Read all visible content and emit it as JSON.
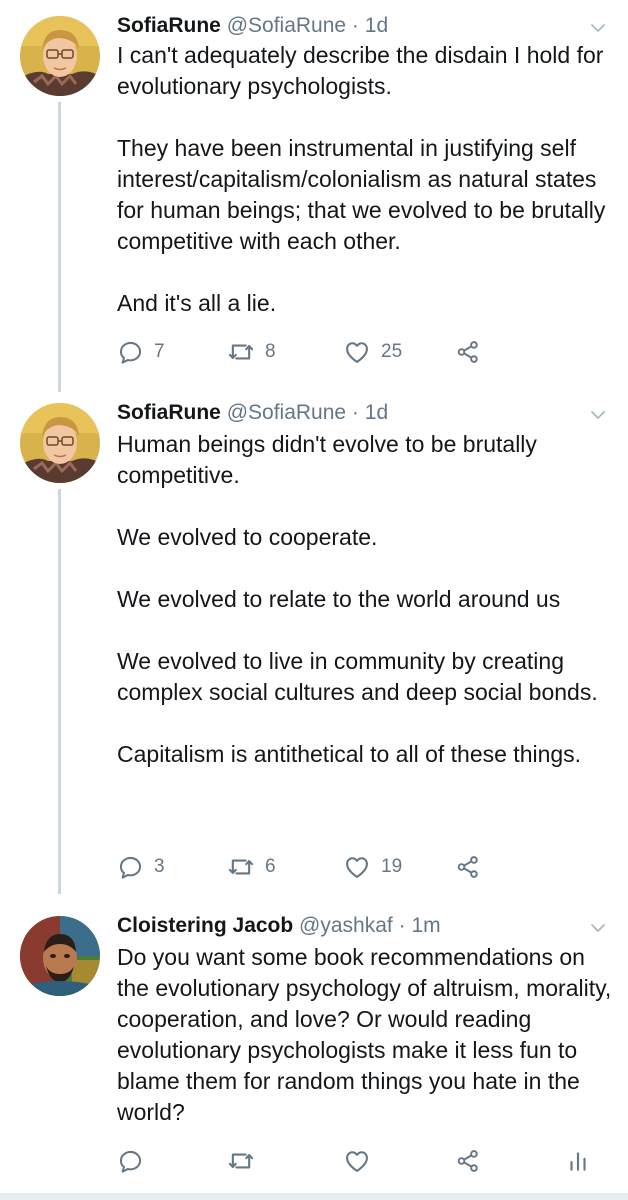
{
  "tweets": [
    {
      "name": "SofiaRune",
      "handle": "@SofiaRune",
      "separator": "·",
      "time": "1d",
      "paragraphs": [
        "I can't adequately describe the disdain I hold for evolutionary psychologists.",
        "They have been instrumental in justifying self interest/capitalism/colonialism as natural states for human beings; that we evolved to be brutally competitive with each other.",
        "And it's all a lie."
      ],
      "replies": "7",
      "retweets": "8",
      "likes": "25"
    },
    {
      "name": "SofiaRune",
      "handle": "@SofiaRune",
      "separator": "·",
      "time": "1d",
      "paragraphs": [
        "Human beings didn't evolve to be brutally competitive.",
        "We evolved to cooperate.",
        "We evolved to relate to the world around us",
        "We evolved to live in community by creating complex social cultures and deep social bonds.",
        "Capitalism is antithetical to all of these things."
      ],
      "replies": "3",
      "retweets": "6",
      "likes": "19"
    },
    {
      "name": "Cloistering Jacob",
      "handle": "@yashkaf",
      "separator": "·",
      "time": "1m",
      "paragraphs": [
        "Do you want some book recommendations on the evolutionary psychology of altruism, morality, cooperation, and love? Or would reading evolutionary psychologists make it less fun to blame them for random things you hate in the world?"
      ]
    }
  ],
  "icons": {
    "reply": "reply-icon",
    "retweet": "retweet-icon",
    "like": "heart-icon",
    "share": "share-icon",
    "analytics": "analytics-icon",
    "caret": "chevron-down-icon"
  },
  "colors": {
    "text": "#14171a",
    "secondary": "#657786",
    "thread_line": "#ccd6dd"
  }
}
